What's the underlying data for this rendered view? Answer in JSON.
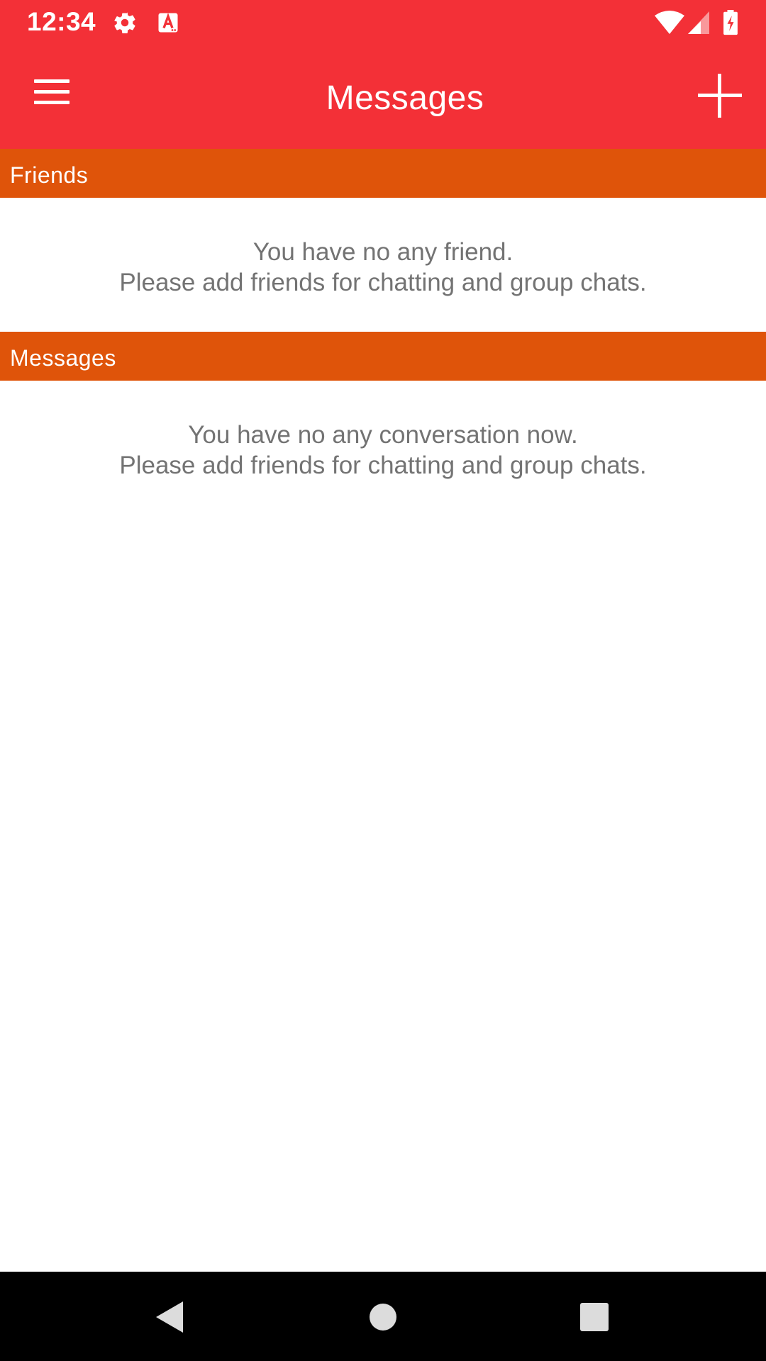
{
  "status_bar": {
    "time": "12:34",
    "left_icons": [
      "gear-icon",
      "text-a-icon"
    ],
    "right_icons": [
      "wifi-icon",
      "cell-signal-icon",
      "battery-charging-icon"
    ]
  },
  "app_bar": {
    "title": "Messages",
    "menu_icon": "hamburger-menu-icon",
    "action_icon": "plus-icon",
    "background_color": "#f33037"
  },
  "sections": {
    "friends": {
      "header": "Friends",
      "empty_line1": "You have no any friend.",
      "empty_line2": "Please add friends for chatting and group chats."
    },
    "messages": {
      "header": "Messages",
      "empty_line1": "You have no any conversation now.",
      "empty_line2": "Please add friends for chatting and group chats."
    },
    "header_color": "#df540a"
  },
  "nav_bar": {
    "buttons": [
      "back-icon",
      "home-icon",
      "recents-icon"
    ]
  }
}
